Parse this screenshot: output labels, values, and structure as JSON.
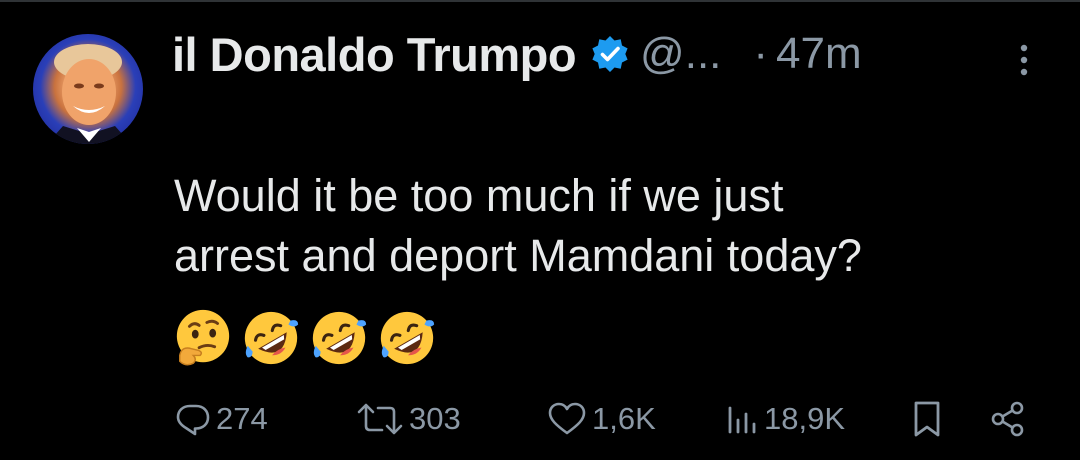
{
  "post": {
    "author_name": "il Donaldo Trumpo",
    "handle": "@...",
    "separator": "·",
    "time": "47m",
    "text_line1": "Would it be too much if we just",
    "text_line2": "arrest and deport Mamdani today?",
    "emojis": [
      "thinking-face-emoji",
      "rolling-on-floor-laughing-emoji",
      "rolling-on-floor-laughing-emoji",
      "rolling-on-floor-laughing-emoji"
    ]
  },
  "actions": {
    "replies": "274",
    "reposts": "303",
    "likes": "1,6K",
    "views": "18,9K"
  },
  "icons": {
    "verified": "verified-badge-icon",
    "more": "more-options-icon",
    "reply": "reply-icon",
    "repost": "repost-icon",
    "like": "heart-icon",
    "views": "views-bar-chart-icon",
    "bookmark": "bookmark-icon",
    "share": "share-icon"
  },
  "colors": {
    "background": "#000000",
    "text_primary": "#e7e9ea",
    "text_secondary": "#8b98a5",
    "verified_blue": "#1d9bf0",
    "emoji_yellow": "#ffc83d"
  }
}
